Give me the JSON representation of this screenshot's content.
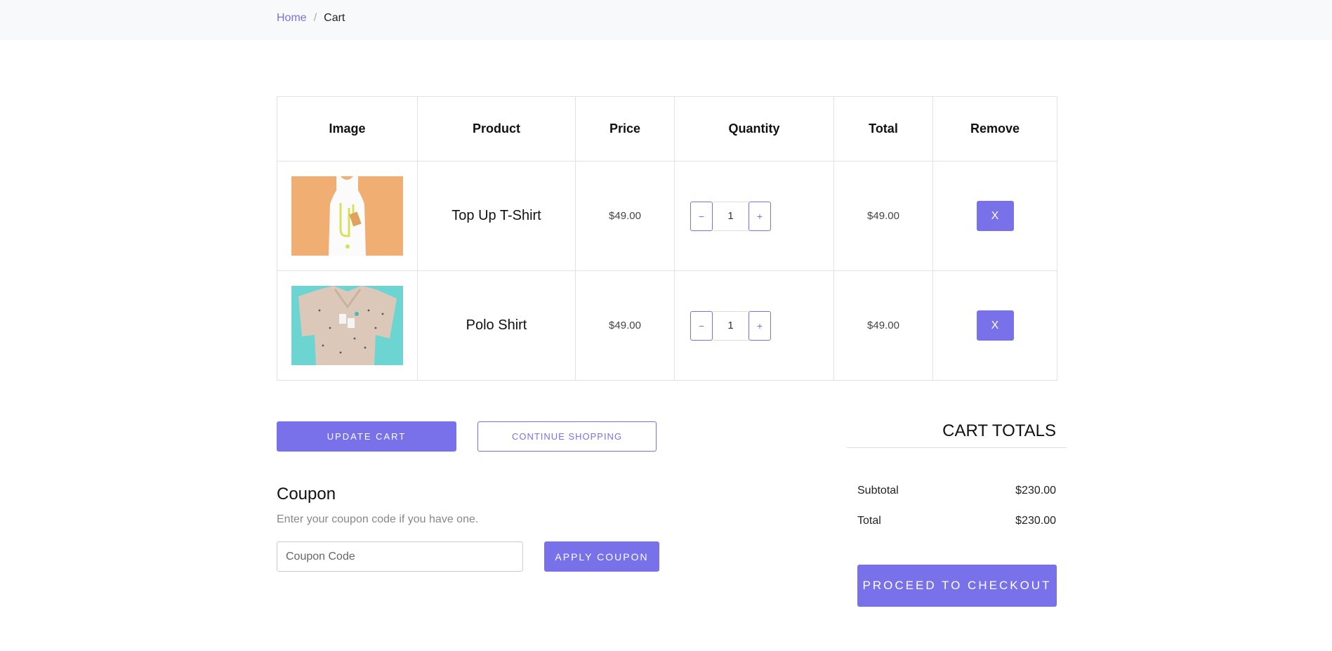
{
  "breadcrumb": {
    "home": "Home",
    "separator": "/",
    "current": "Cart"
  },
  "table": {
    "headers": [
      "Image",
      "Product",
      "Price",
      "Quantity",
      "Total",
      "Remove"
    ],
    "rows": [
      {
        "image_icon": "white-tank-top-orange-background",
        "product": "Top Up T-Shirt",
        "price": "$49.00",
        "quantity": "1",
        "total": "$49.00",
        "remove": "X"
      },
      {
        "image_icon": "polo-shirts-teal-background",
        "product": "Polo Shirt",
        "price": "$49.00",
        "quantity": "1",
        "total": "$49.00",
        "remove": "X"
      }
    ],
    "qty_minus": "−",
    "qty_plus": "+"
  },
  "actions": {
    "update_cart": "UPDATE CART",
    "continue_shopping": "CONTINUE SHOPPING"
  },
  "coupon": {
    "title": "Coupon",
    "description": "Enter your coupon code if you have one.",
    "placeholder": "Coupon Code",
    "apply": "APPLY COUPON"
  },
  "totals": {
    "title": "CART TOTALS",
    "subtotal_label": "Subtotal",
    "subtotal_value": "$230.00",
    "total_label": "Total",
    "total_value": "$230.00",
    "checkout": "PROCEED TO CHECKOUT"
  },
  "colors": {
    "accent": "#7971ea",
    "breadcrumb_bg": "#f8f9fa",
    "border": "#e2e2e2"
  }
}
